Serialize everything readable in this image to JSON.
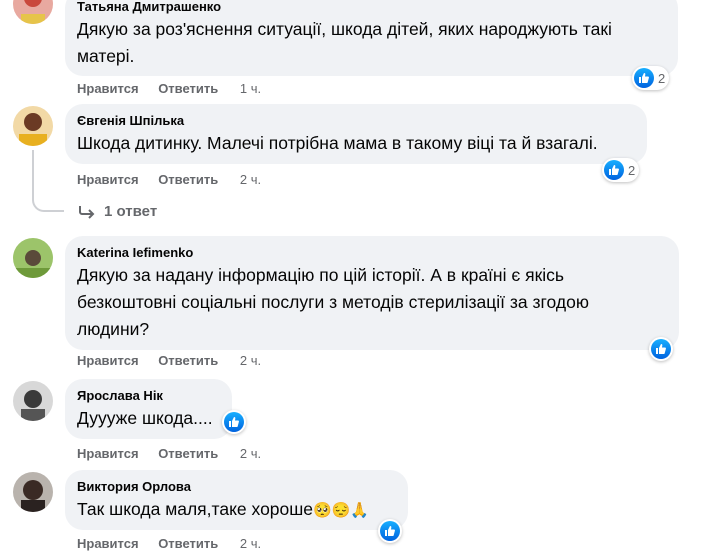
{
  "labels": {
    "like": "Нравится",
    "reply": "Ответить"
  },
  "comments": [
    {
      "author": "Татьяна Дмитрашенко",
      "lines": [
        "Дякую за роз'яснення ситуації, шкода дітей, яких народжують такі",
        "матері."
      ],
      "time": "1 ч.",
      "reactions": "2"
    },
    {
      "author": "Євгенія Шпілька",
      "lines": [
        "Шкода дитинку. Малечі потрібна мама в такому віці та й взагалі."
      ],
      "time": "2 ч.",
      "reactions": "2",
      "replies_label": "1 ответ"
    },
    {
      "author": "Katerina Iefimenko",
      "lines": [
        "Дякую за надану інформацію по цій історії. А в країні є якісь",
        "безкоштовні соціальні послуги з методів стерилізації за згодою",
        "людини?"
      ],
      "time": "2 ч."
    },
    {
      "author": "Ярослава Нік",
      "lines": [
        "Дуууже шкода...."
      ],
      "time": "2 ч."
    },
    {
      "author": "Виктория Орлова",
      "lines": [
        "Так шкода маля,таке хороше"
      ],
      "emoji": "🥺😔🙏",
      "time": "2 ч."
    }
  ],
  "colors": {
    "bubble": "#f0f2f5",
    "like_blue": "#1877f2",
    "meta": "#65676b"
  }
}
